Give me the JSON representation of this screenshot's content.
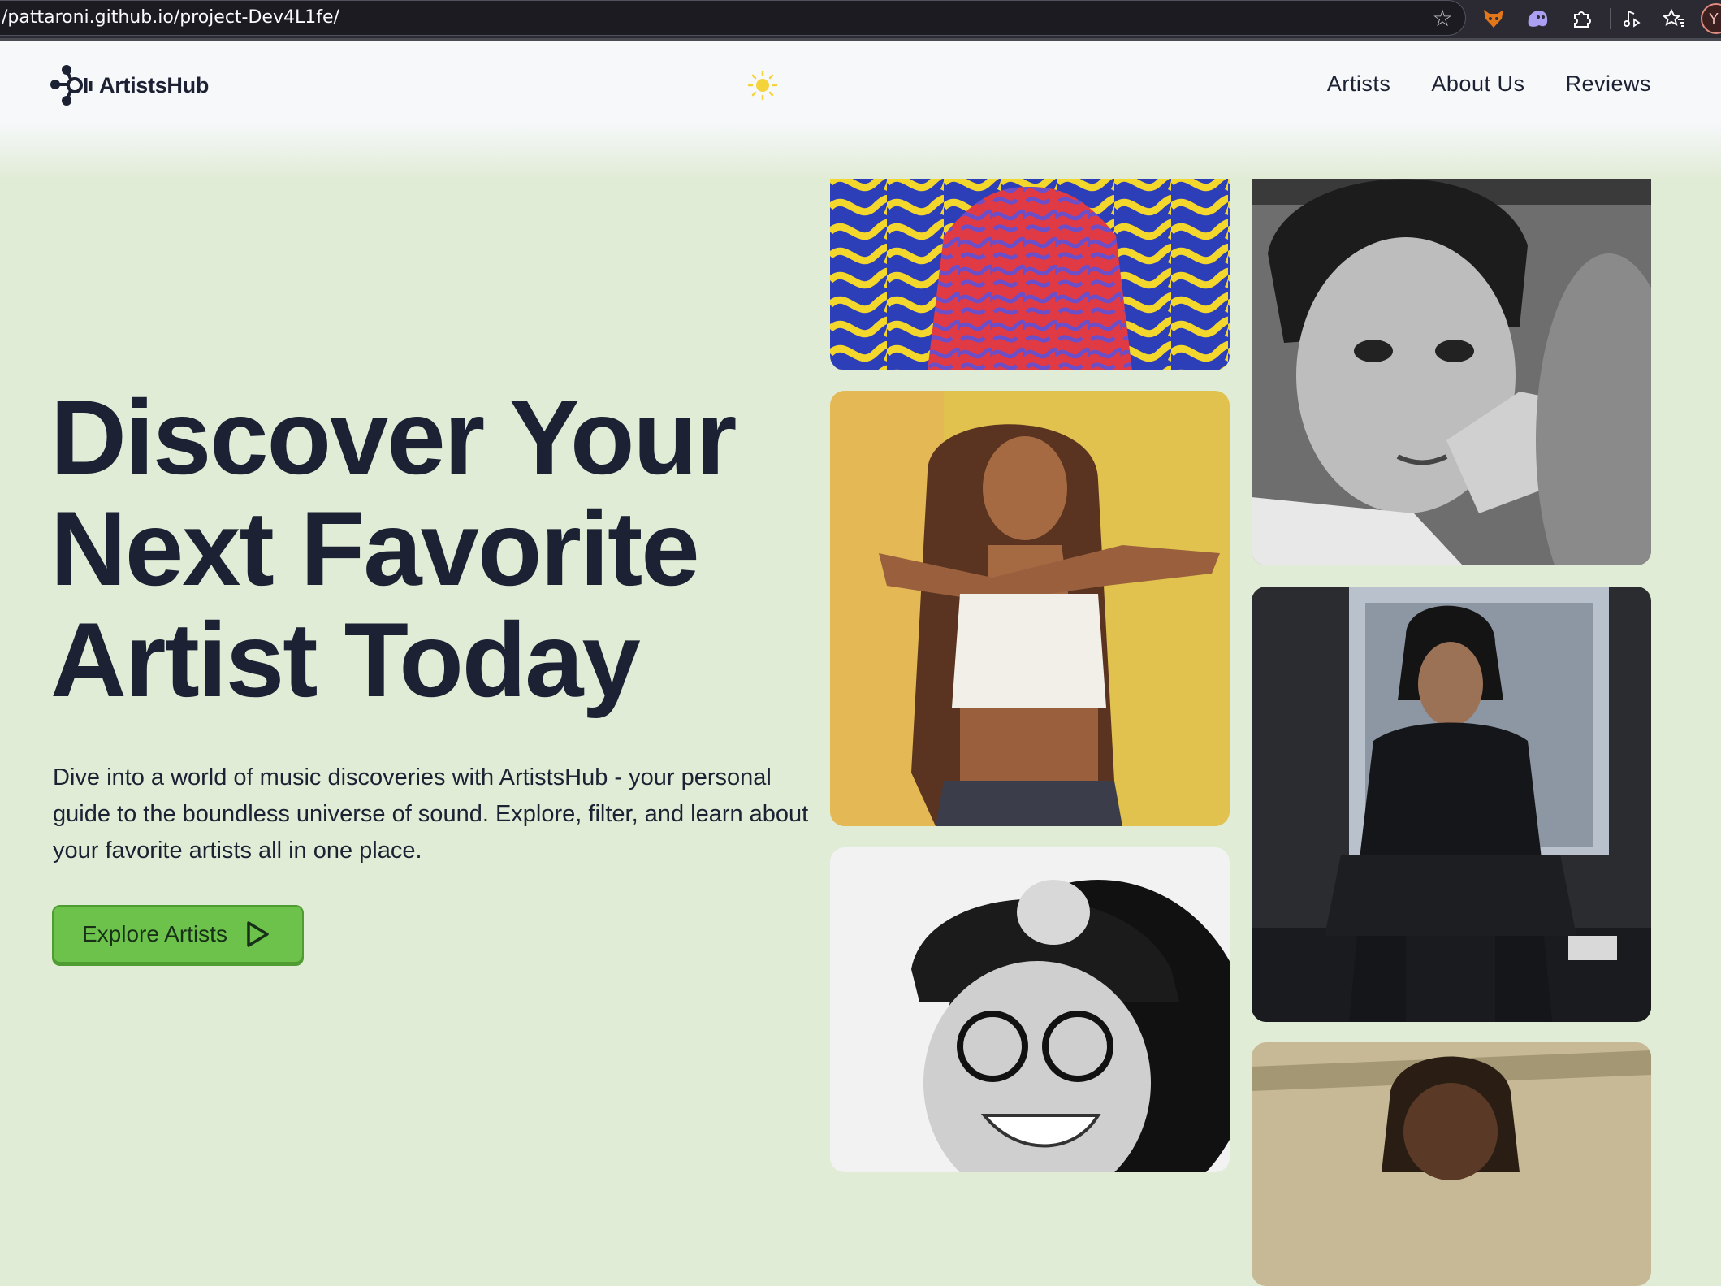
{
  "browser": {
    "url": "/pattaroni.github.io/project-Dev4L1fe/",
    "avatar_initial": "Y"
  },
  "header": {
    "brand": "ArtistsHub",
    "nav": [
      {
        "label": "Artists"
      },
      {
        "label": "About Us"
      },
      {
        "label": "Reviews"
      }
    ]
  },
  "hero": {
    "title": "Discover Your Next Favorite Artist Today",
    "description": "Dive into a world of music discoveries with ArtistsHub - your personal guide to the boundless universe of sound. Explore, filter, and learn about your favorite artists all in one place.",
    "cta_label": "Explore Artists"
  },
  "icons": {
    "logo": "molecule-logo-icon",
    "theme": "sun-icon",
    "cta": "play-triangle-icon",
    "bookmark": "star-icon"
  },
  "colors": {
    "background": "#e1ecd6",
    "text": "#1c2233",
    "accent": "#6cc24a",
    "sun": "#f5d33b"
  }
}
